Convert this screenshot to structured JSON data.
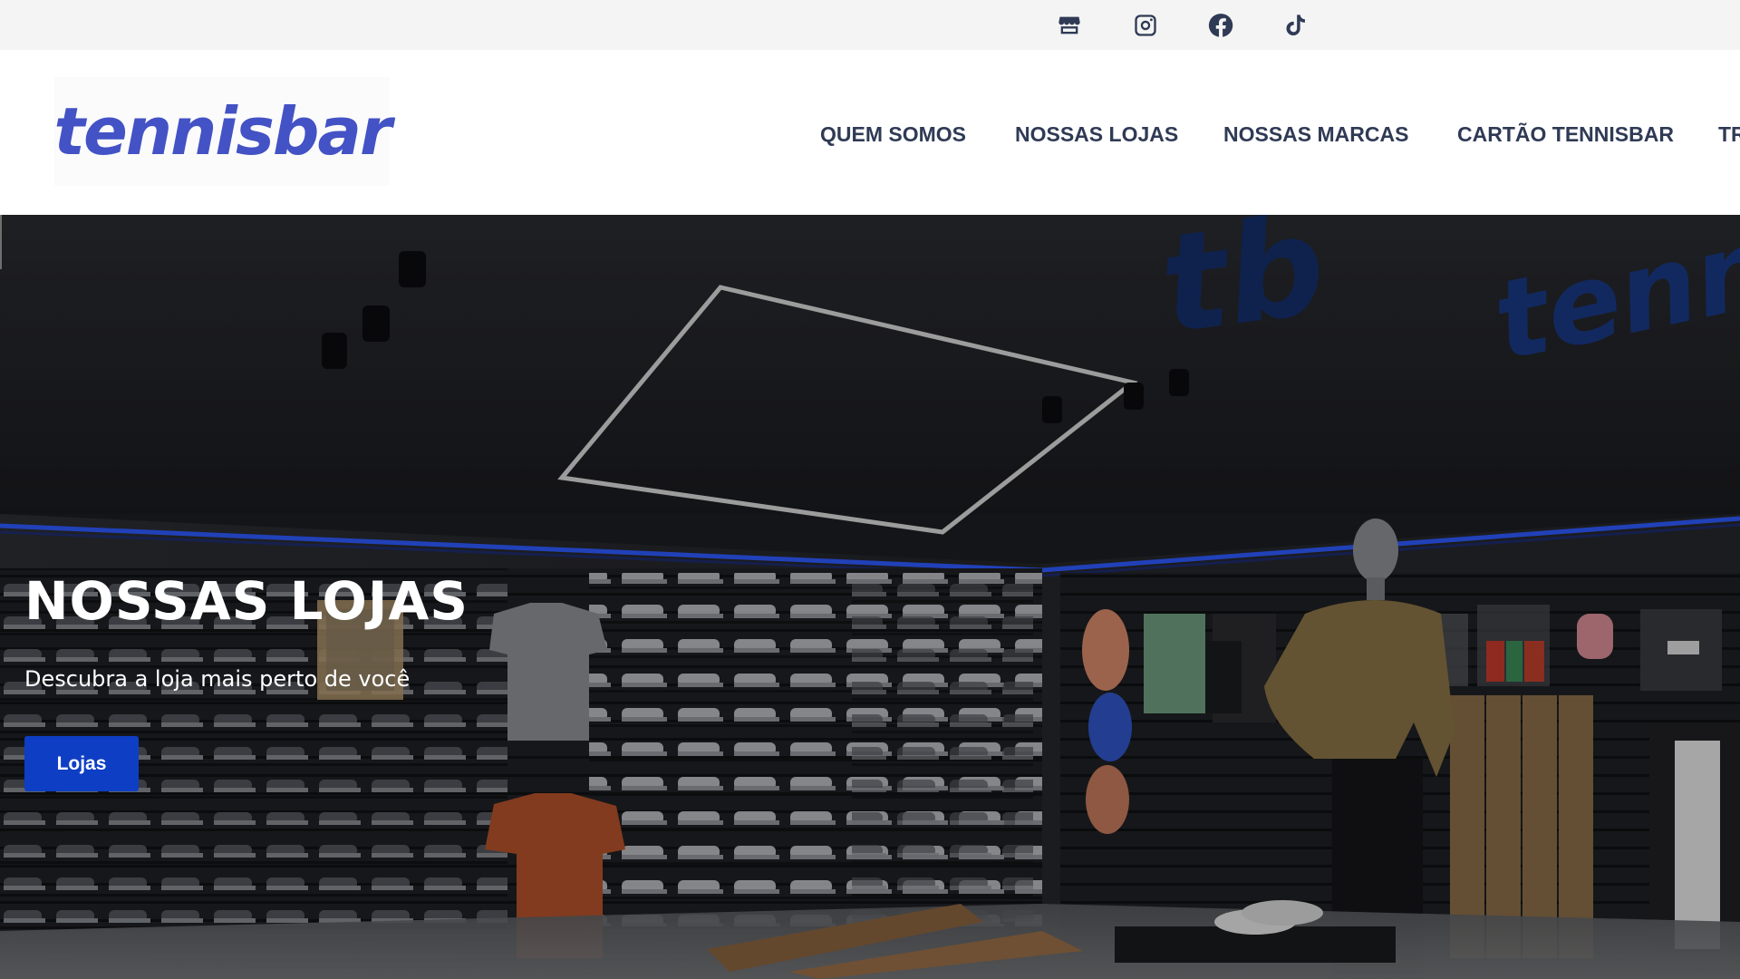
{
  "topbar": {
    "icons": [
      "store-icon",
      "instagram-icon",
      "facebook-icon",
      "tiktok-icon"
    ]
  },
  "header": {
    "logo_text": "tennisbar",
    "nav": [
      {
        "label": "QUEM SOMOS"
      },
      {
        "label": "NOSSAS LOJAS"
      },
      {
        "label": "NOSSAS MARCAS"
      },
      {
        "label": "CARTÃO TENNISBAR"
      },
      {
        "label": "TR"
      }
    ]
  },
  "hero": {
    "title": "NOSSAS LOJAS",
    "subtitle": "Descubra a loja mais perto de você",
    "button_label": "Lojas"
  },
  "colors": {
    "brand": "#4352c5",
    "nav_text": "#2f3a55",
    "button": "#0e3ec4",
    "topbar_bg": "#f4f4f4"
  }
}
